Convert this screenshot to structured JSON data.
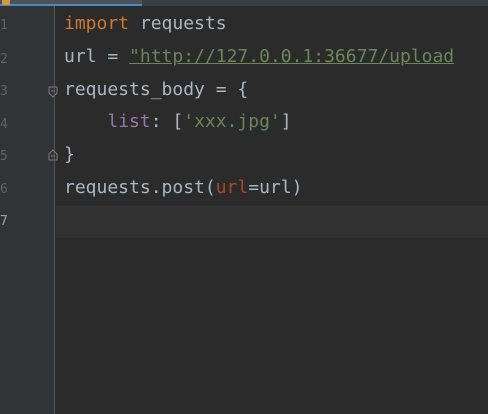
{
  "gutter": {
    "line_numbers": [
      "1",
      "2",
      "3",
      "4",
      "5",
      "6",
      "7"
    ],
    "current_line": "7"
  },
  "code": {
    "line1": {
      "keyword": "import",
      "rest": " requests"
    },
    "line2": {
      "var": "url",
      "op": " = ",
      "string": "\"http://127.0.0.1:36677/upload"
    },
    "line3": {
      "text": "requests_body = {"
    },
    "line4": {
      "indent": "    ",
      "key": "list",
      "sep": ": [",
      "string": "'xxx.jpg'",
      "close": "]"
    },
    "line5": {
      "text": "}"
    },
    "line6": {
      "call": "requests.post(",
      "param": "url",
      "eq": "=",
      "arg": "url",
      "close": ")"
    },
    "line7": {
      "text": ""
    }
  },
  "colors": {
    "background": "#2b2b2b",
    "gutter": "#313335",
    "keyword": "#cc7832",
    "string": "#6a8759",
    "key": "#9876aa",
    "param": "#aa4926",
    "text": "#a9b7c6"
  }
}
